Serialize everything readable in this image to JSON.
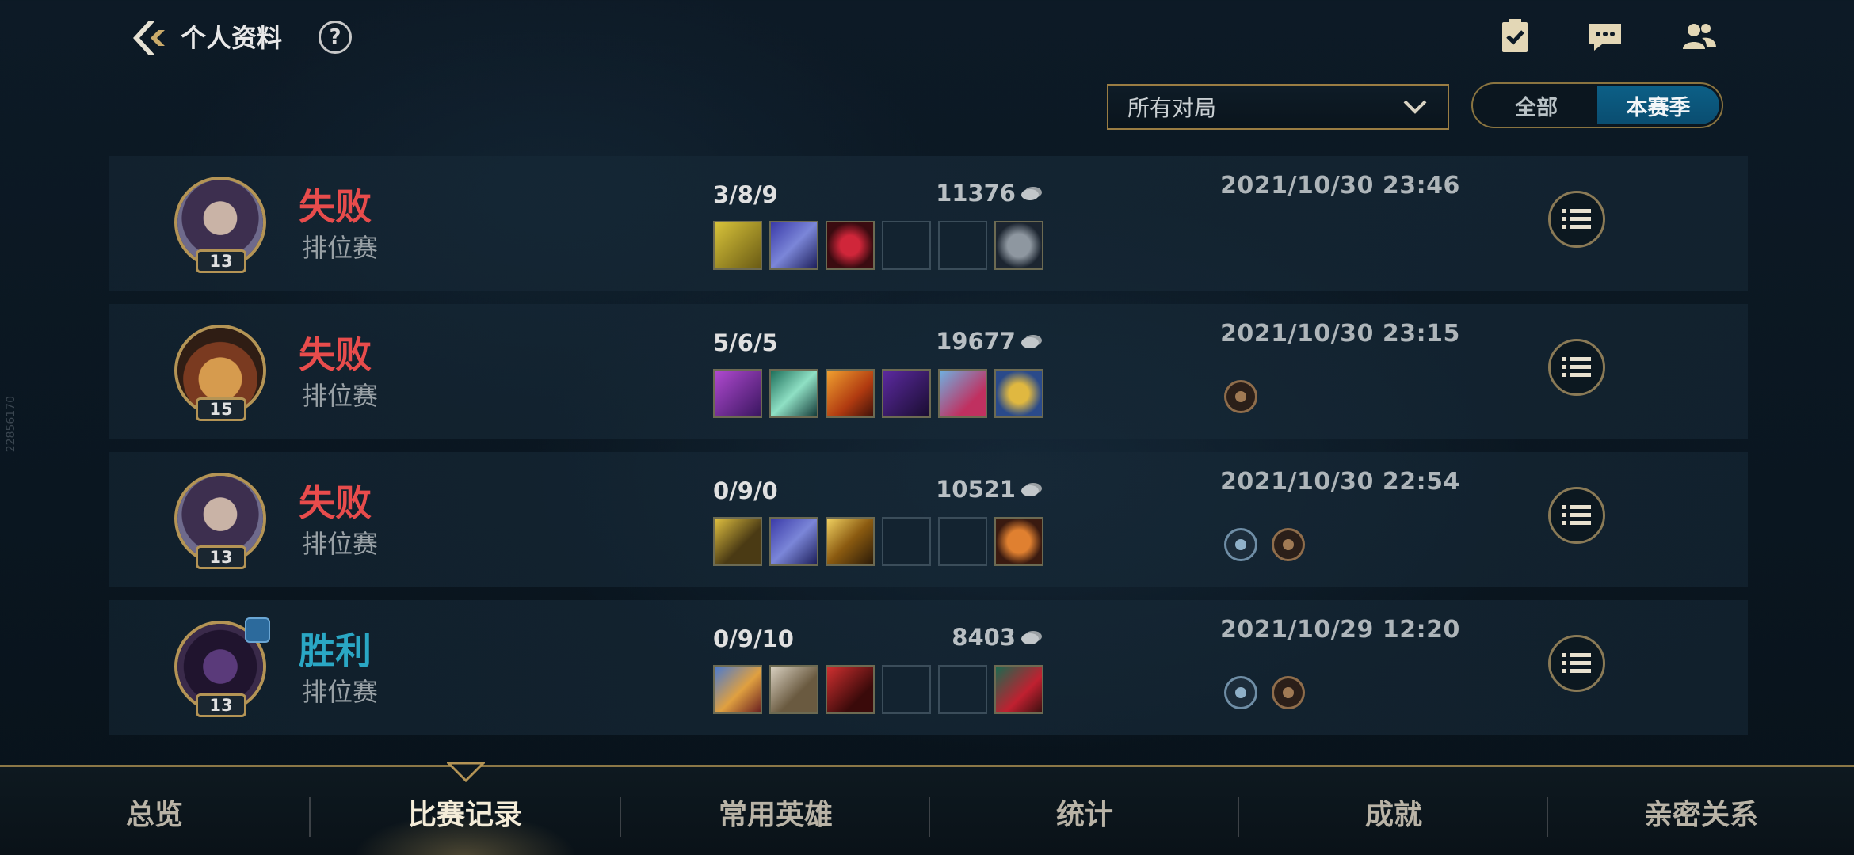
{
  "header": {
    "title": "个人资料",
    "help_label": "?"
  },
  "filters": {
    "mode_dropdown": {
      "value": "所有对局"
    },
    "season_toggle": {
      "options": [
        "全部",
        "本赛季"
      ],
      "selected": "本赛季"
    }
  },
  "matches": [
    {
      "level": "13",
      "result": "失败",
      "result_type": "loss",
      "mode": "排位赛",
      "kda": "3/8/9",
      "gold": "11376",
      "time": "2021/10/30 23:46",
      "items": [
        "item-yellow-shield",
        "item-blue-sword",
        "item-red-gem",
        "",
        ""
      ],
      "trinket": "ward-trinket",
      "medals": []
    },
    {
      "level": "15",
      "result": "失败",
      "result_type": "loss",
      "mode": "排位赛",
      "kda": "5/6/5",
      "gold": "19677",
      "time": "2021/10/30 23:15",
      "items": [
        "item-purple-dagger",
        "item-green-rifle",
        "item-fire-blade",
        "item-dark-hat",
        "item-blue-mask"
      ],
      "trinket": "gold-trinket",
      "medals": [
        "bronze"
      ]
    },
    {
      "level": "13",
      "result": "失败",
      "result_type": "loss",
      "mode": "排位赛",
      "kda": "0/9/0",
      "gold": "10521",
      "time": "2021/10/30 22:54",
      "items": [
        "item-gold-blade",
        "item-blue-sword",
        "item-lightning-blade",
        "",
        ""
      ],
      "trinket": "orange-trinket",
      "medals": [
        "blue",
        "bronze"
      ]
    },
    {
      "level": "13",
      "result": "胜利",
      "result_type": "win",
      "mode": "排位赛",
      "kda": "0/9/10",
      "gold": "8403",
      "time": "2021/10/29 12:20",
      "items": [
        "item-crest-shield",
        "item-gauntlet",
        "item-red-claw",
        "",
        ""
      ],
      "trinket": "boots-trinket",
      "medals": [
        "blue",
        "bronze"
      ],
      "party": true
    }
  ],
  "bottom_nav": {
    "tabs": [
      "总览",
      "比赛记录",
      "常用英雄",
      "统计",
      "成就",
      "亲密关系"
    ],
    "active": "比赛记录"
  },
  "colors": {
    "loss": "#e84c4c",
    "win": "#2aa7c4",
    "gold_accent": "#b49455",
    "toggle_active": "#0c5f86"
  },
  "side_note": "22856170"
}
